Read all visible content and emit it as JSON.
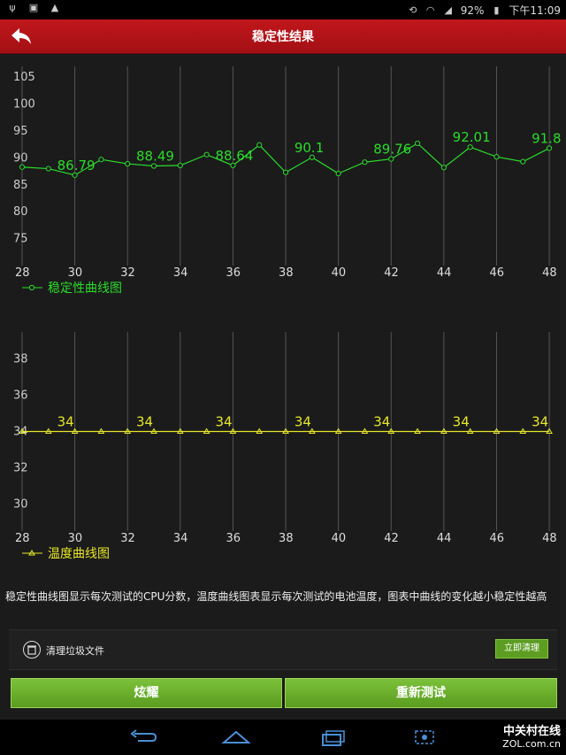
{
  "status_bar": {
    "battery": "92%",
    "time": "下午11:09"
  },
  "header": {
    "title": "稳定性结果"
  },
  "charts": {
    "stability": {
      "type": "line",
      "legend": "稳定性曲线图",
      "color": "#2bdb2b",
      "x_ticks": [
        "28",
        "30",
        "32",
        "34",
        "36",
        "38",
        "40",
        "42",
        "44",
        "46",
        "48"
      ],
      "y_ticks": [
        "105",
        "100",
        "95",
        "90",
        "85",
        "80",
        "75"
      ],
      "ylim": [
        70,
        107
      ],
      "xlim": [
        28,
        48.5
      ],
      "x": [
        28,
        29,
        30,
        31,
        32,
        33,
        34,
        35,
        36,
        37,
        38,
        39,
        40,
        41,
        42,
        43,
        44,
        45,
        46,
        47,
        48
      ],
      "values": [
        88.3,
        88.0,
        86.8,
        89.7,
        88.9,
        88.5,
        88.6,
        90.6,
        88.6,
        92.4,
        87.3,
        90.1,
        87.1,
        89.2,
        89.8,
        92.7,
        88.2,
        92.0,
        90.2,
        89.3,
        91.8
      ],
      "labels": [
        {
          "x": 30,
          "text": "86.79"
        },
        {
          "x": 33,
          "text": "88.49"
        },
        {
          "x": 36,
          "text": "88.64"
        },
        {
          "x": 39,
          "text": "90.1"
        },
        {
          "x": 42,
          "text": "89.76"
        },
        {
          "x": 45,
          "text": "92.01"
        },
        {
          "x": 48,
          "text": "91.8"
        }
      ]
    },
    "temperature": {
      "type": "line",
      "legend": "温度曲线图",
      "color": "#e6e62a",
      "x_ticks": [
        "28",
        "30",
        "32",
        "34",
        "36",
        "38",
        "40",
        "42",
        "44",
        "46",
        "48"
      ],
      "y_ticks": [
        "38",
        "36",
        "34",
        "32",
        "30"
      ],
      "ylim": [
        28.5,
        39.5
      ],
      "xlim": [
        28,
        48.5
      ],
      "x": [
        28,
        29,
        30,
        31,
        32,
        33,
        34,
        35,
        36,
        37,
        38,
        39,
        40,
        41,
        42,
        43,
        44,
        45,
        46,
        47,
        48
      ],
      "values": [
        34,
        34,
        34,
        34,
        34,
        34,
        34,
        34,
        34,
        34,
        34,
        34,
        34,
        34,
        34,
        34,
        34,
        34,
        34,
        34,
        34
      ],
      "labels": [
        {
          "x": 30,
          "text": "34"
        },
        {
          "x": 33,
          "text": "34"
        },
        {
          "x": 36,
          "text": "34"
        },
        {
          "x": 39,
          "text": "34"
        },
        {
          "x": 42,
          "text": "34"
        },
        {
          "x": 45,
          "text": "34"
        },
        {
          "x": 48,
          "text": "34"
        }
      ]
    }
  },
  "description": "稳定性曲线图显示每次测试的CPU分数，温度曲线图表显示每次测试的电池温度，图表中曲线的变化越小稳定性越高",
  "cleanup": {
    "label": "清理垃圾文件",
    "button": "立即清理"
  },
  "buttons": {
    "show_off": "炫耀",
    "retest": "重新测试"
  },
  "watermark": {
    "line1": "中关村在线",
    "line2": "ZOL.com.cn"
  }
}
